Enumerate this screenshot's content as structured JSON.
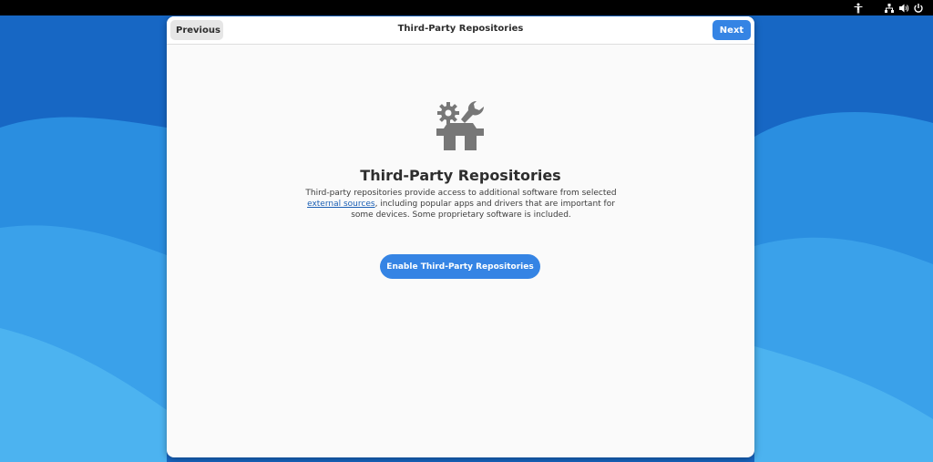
{
  "topbar": {
    "icons": [
      "accessibility-icon",
      "network-icon",
      "volume-icon",
      "power-icon"
    ]
  },
  "window": {
    "title": "Third-Party Repositories",
    "previous_label": "Previous",
    "next_label": "Next"
  },
  "page": {
    "icon": "repository-tools-icon",
    "heading": "Third-Party Repositories",
    "description_before": "Third-party repositories provide access to additional software from selected ",
    "description_link": "external sources",
    "description_after": ", including popular apps and drivers that are important for some devices. Some proprietary software is included.",
    "enable_button": "Enable Third-Party Repositories"
  },
  "colors": {
    "accent": "#3584e4",
    "desktop_blue": "#1a74c9",
    "link": "#1a5fb4"
  }
}
